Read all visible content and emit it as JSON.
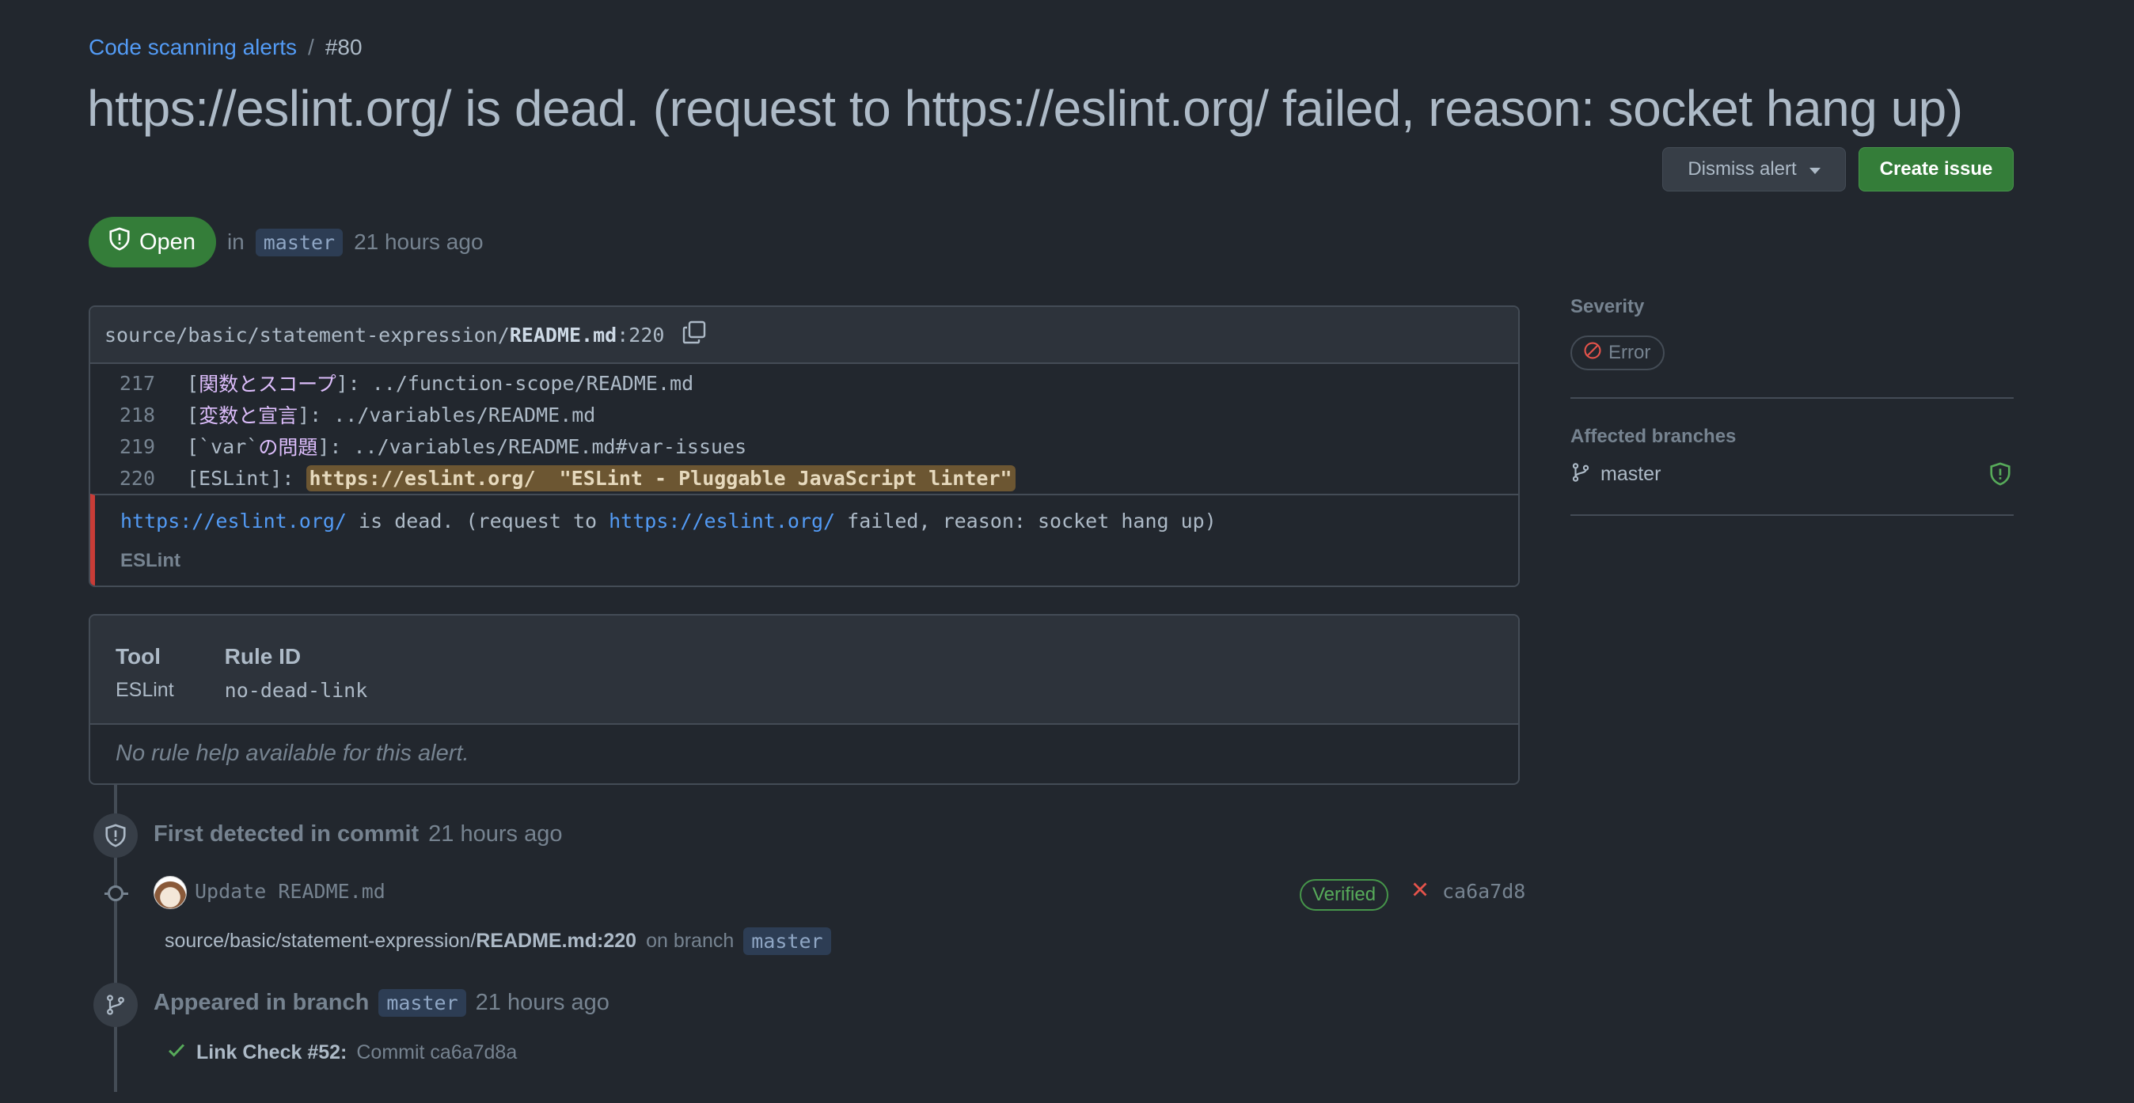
{
  "breadcrumb": {
    "parent": "Code scanning alerts",
    "separator": "/",
    "current": "#80"
  },
  "title": "https://eslint.org/ is dead. (request to https://eslint.org/ failed, reason: socket hang up)",
  "actions": {
    "dismiss_label": "Dismiss alert",
    "create_label": "Create issue"
  },
  "status": {
    "state": "Open",
    "in_word": "in",
    "branch": "master",
    "time": "21 hours ago"
  },
  "code": {
    "path_prefix": "source/basic/statement-expression/",
    "path_file": "README.md",
    "path_line": ":220",
    "lines": [
      {
        "num": "217",
        "open": "[",
        "jp": "関数とスコープ",
        "rest": "]: ../function-scope/README.md"
      },
      {
        "num": "218",
        "open": "[",
        "jp": "変数と宣言",
        "rest": "]: ../variables/README.md"
      },
      {
        "num": "219",
        "open": "[`var`",
        "jp": "の問題",
        "rest": "]: ../variables/README.md#var-issues"
      }
    ],
    "line220": {
      "num": "220",
      "prefix": "[ESLint]: ",
      "highlight": "https://eslint.org/  \"ESLint - Pluggable JavaScript linter\""
    },
    "alert": {
      "link1": "https://eslint.org/",
      "text1": " is dead. (request to ",
      "link2": "https://eslint.org/",
      "text2": " failed, reason: socket hang up)",
      "tool": "ESLint"
    }
  },
  "tool_info": {
    "tool_header": "Tool",
    "tool_value": "ESLint",
    "rule_header": "Rule ID",
    "rule_value": "no-dead-link",
    "help": "No rule help available for this alert."
  },
  "timeline": {
    "first_detected": {
      "label": "First detected in commit",
      "time": "21 hours ago"
    },
    "commit": {
      "message": "Update README.md",
      "verified": "Verified",
      "sha": "ca6a7d8"
    },
    "location": {
      "path_prefix": "source/basic/statement-expression/",
      "path_bold": "README.md:220",
      "on_branch": "on branch",
      "branch": "master"
    },
    "appeared": {
      "label": "Appeared in branch",
      "branch": "master",
      "time": "21 hours ago"
    },
    "check": {
      "name": "Link Check #52:",
      "detail": "Commit ca6a7d8a"
    }
  },
  "sidebar": {
    "severity_label": "Severity",
    "severity_value": "Error",
    "affected_label": "Affected branches",
    "branch": "master"
  },
  "colors": {
    "accent_green": "#347d39",
    "link_blue": "#539bf5",
    "error_red": "#c93c37",
    "bg": "#22272e"
  }
}
